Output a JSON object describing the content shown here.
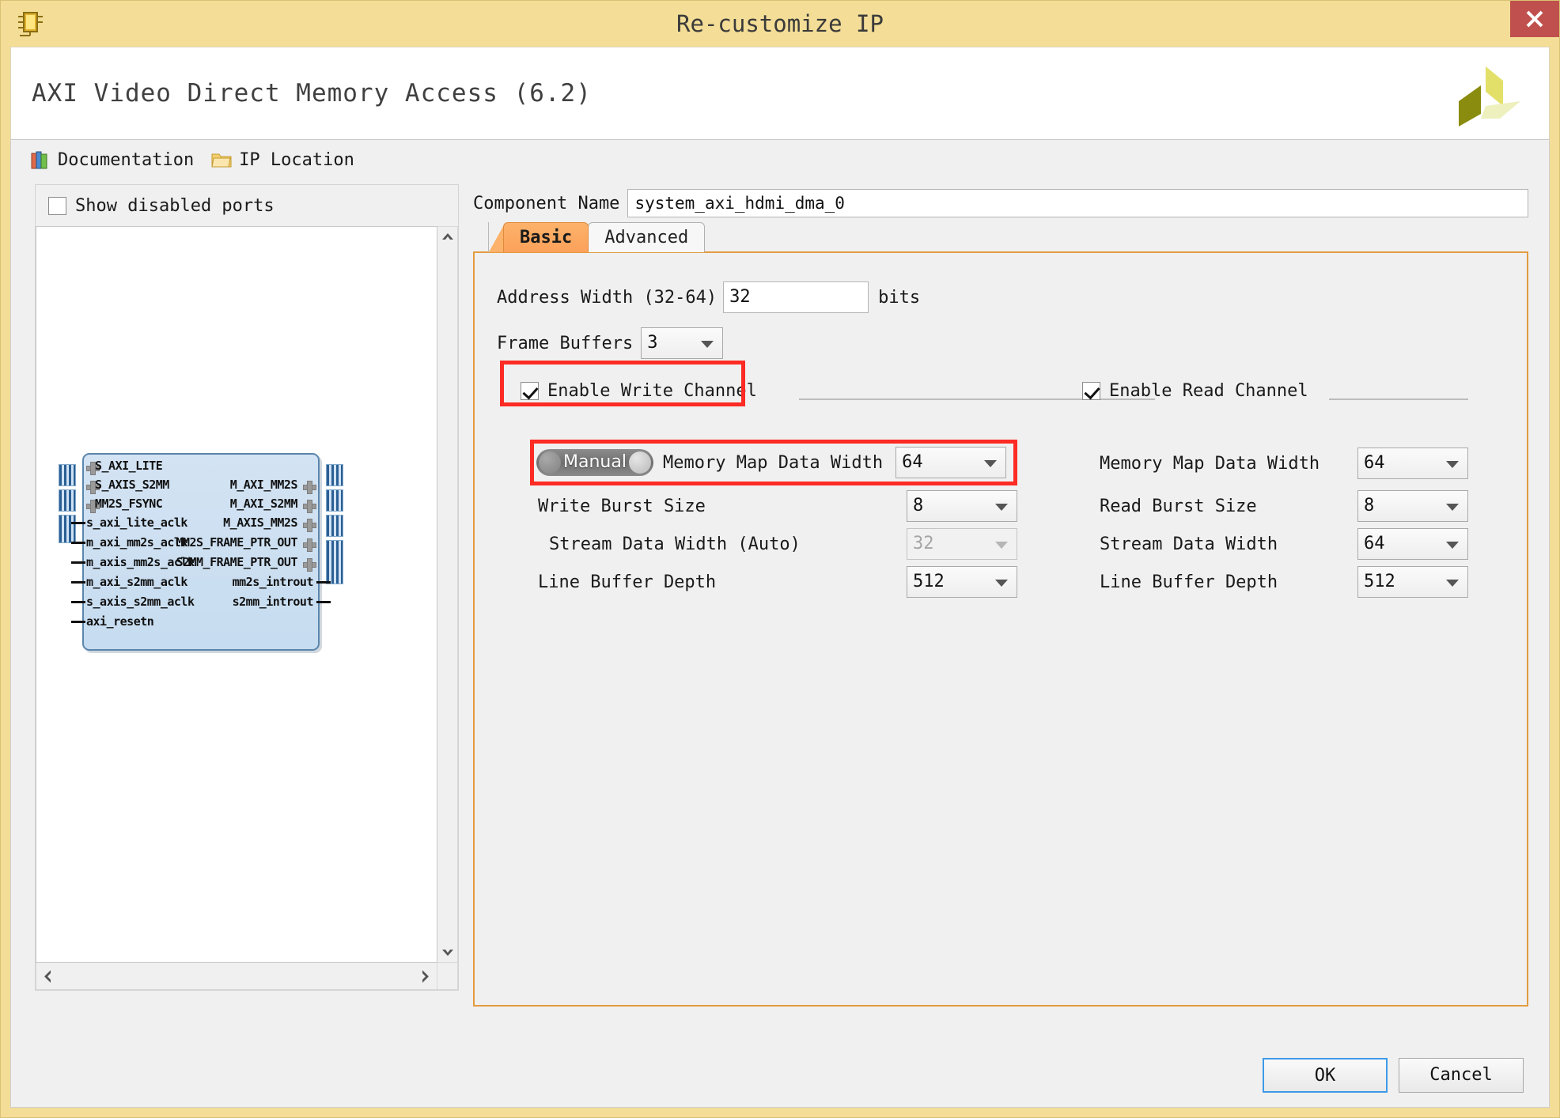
{
  "window": {
    "title": "Re-customize IP",
    "chip_icon": "ip-chip-icon",
    "close_icon": "close-icon"
  },
  "header": {
    "ip_title": "AXI Video Direct Memory Access (6.2)",
    "logo": "xilinx-logo"
  },
  "toolbar": {
    "documentation_label": "Documentation",
    "documentation_icon": "books-icon",
    "ip_location_label": "IP Location",
    "ip_location_icon": "folder-icon"
  },
  "left_panel": {
    "show_disabled_ports_label": "Show disabled ports",
    "show_disabled_ports_checked": false,
    "scroll": {
      "up_icon": "chevron-up-icon",
      "down_icon": "chevron-down-icon",
      "left_icon": "chevron-left-icon",
      "right_icon": "chevron-right-icon"
    },
    "diagram": {
      "left_ports": [
        "S_AXI_LITE",
        "S_AXIS_S2MM",
        "MM2S_FSYNC",
        "s_axi_lite_aclk",
        "m_axi_mm2s_aclk",
        "m_axis_mm2s_aclk",
        "m_axi_s2mm_aclk",
        "s_axis_s2mm_aclk",
        "axi_resetn"
      ],
      "right_ports": [
        "M_AXI_MM2S",
        "M_AXI_S2MM",
        "M_AXIS_MM2S",
        "MM2S_FRAME_PTR_OUT",
        "S2MM_FRAME_PTR_OUT",
        "mm2s_introut",
        "s2mm_introut"
      ]
    }
  },
  "form": {
    "component_name_label": "Component Name",
    "component_name_value": "system_axi_hdmi_dma_0",
    "tabs": [
      {
        "label": "Basic",
        "active": true
      },
      {
        "label": "Advanced",
        "active": false
      }
    ],
    "address_width_label": "Address Width (32-64)",
    "address_width_value": "32",
    "address_width_units": "bits",
    "frame_buffers_label": "Frame Buffers",
    "frame_buffers_value": "3",
    "write_channel": {
      "enable_label": "Enable Write Channel",
      "enable_checked": true,
      "toggle_label": "Manual",
      "memory_map_data_width_label": "Memory Map Data Width",
      "memory_map_data_width_value": "64",
      "burst_size_label": "Write Burst Size",
      "burst_size_value": "8",
      "stream_data_width_label": "Stream Data Width (Auto)",
      "stream_data_width_value": "32",
      "stream_data_width_disabled": true,
      "line_buffer_depth_label": "Line Buffer Depth",
      "line_buffer_depth_value": "512"
    },
    "read_channel": {
      "enable_label": "Enable Read Channel",
      "enable_checked": true,
      "memory_map_data_width_label": "Memory Map Data Width",
      "memory_map_data_width_value": "64",
      "burst_size_label": "Read Burst Size",
      "burst_size_value": "8",
      "stream_data_width_label": "Stream Data Width",
      "stream_data_width_value": "64",
      "line_buffer_depth_label": "Line Buffer Depth",
      "line_buffer_depth_value": "512"
    }
  },
  "footer": {
    "ok_label": "OK",
    "cancel_label": "Cancel"
  },
  "colors": {
    "title_bar": "#f3dd97",
    "close_button": "#c0504d",
    "tab_active": "#fca15a",
    "panel_border": "#e39b3f",
    "highlight_box": "#fc2b24",
    "block_fill": "#cfe2f4"
  }
}
